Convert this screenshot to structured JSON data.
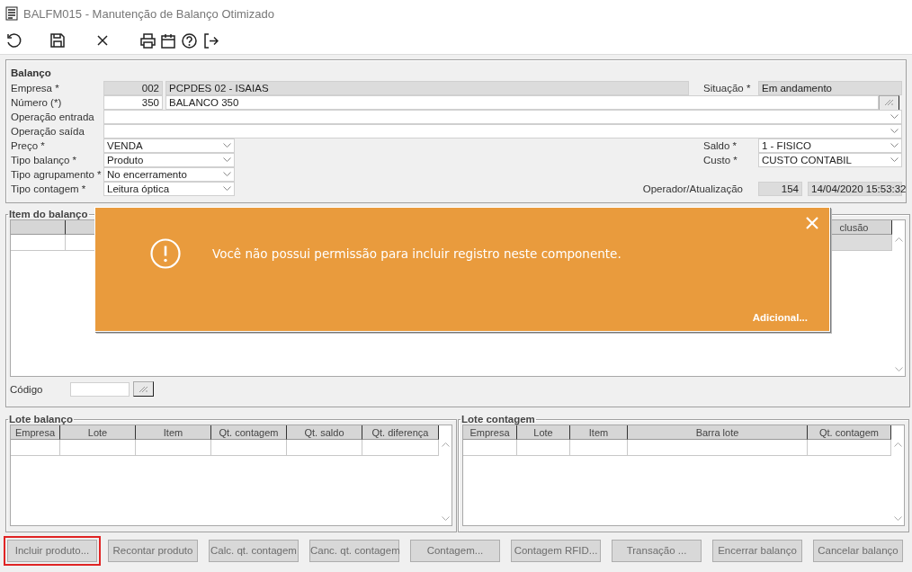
{
  "window": {
    "title": "BALFM015 - Manutenção de Balanço Otimizado"
  },
  "balanco": {
    "title": "Balanço",
    "empresa": {
      "label": "Empresa *",
      "code": "002",
      "name": "PCPDES 02 - ISAIAS",
      "readonly": true
    },
    "situacao": {
      "label": "Situação *",
      "value": "Em andamento",
      "readonly": true
    },
    "numero": {
      "label": "Número (*)",
      "code": "350",
      "name": "BALANCO 350",
      "readonly": false
    },
    "operacao_entrada": {
      "label": "Operação entrada"
    },
    "operacao_saida": {
      "label": "Operação saída"
    },
    "preco": {
      "label": "Preço *",
      "value": "VENDA"
    },
    "saldo": {
      "label": "Saldo *",
      "value": "1 - FISICO"
    },
    "tipo_balanco": {
      "label": "Tipo balanço *",
      "value": "Produto"
    },
    "custo": {
      "label": "Custo *",
      "value": "CUSTO CONTABIL"
    },
    "tipo_agrupamento": {
      "label": "Tipo agrupamento *",
      "value": "No encerramento"
    },
    "tipo_contagem": {
      "label": "Tipo contagem *",
      "value": "Leitura óptica"
    },
    "operador": {
      "label": "Operador/Atualização",
      "code": "154",
      "date": "14/04/2020 15:53:32"
    }
  },
  "item_balanco": {
    "title": "Item do balanço",
    "columns": [
      "clusão"
    ],
    "codigo": {
      "label": "Código"
    }
  },
  "toast": {
    "message": "Você não possui permissão para incluir registro neste componente.",
    "link": "Adicional..."
  },
  "lote_balanco": {
    "title": "Lote balanço",
    "columns": [
      "Empresa",
      "Lote",
      "Item",
      "Qt. contagem",
      "Qt. saldo",
      "Qt. diferença"
    ]
  },
  "lote_contagem": {
    "title": "Lote contagem",
    "columns": [
      "Empresa",
      "Lote",
      "Item",
      "Barra lote",
      "Qt. contagem"
    ]
  },
  "buttons": [
    {
      "label": "Incluir produto...",
      "disabled": true,
      "highlighted": true
    },
    {
      "label": "Recontar produto",
      "disabled": true,
      "highlighted": false
    },
    {
      "label": "Calc. qt. contagem",
      "disabled": true,
      "highlighted": false
    },
    {
      "label": "Canc. qt. contagem",
      "disabled": true,
      "highlighted": false
    },
    {
      "label": "Contagem...",
      "disabled": true,
      "highlighted": false
    },
    {
      "label": "Contagem RFID...",
      "disabled": true,
      "highlighted": false
    },
    {
      "label": "Transação ...",
      "disabled": true,
      "highlighted": false
    },
    {
      "label": "Encerrar balanço",
      "disabled": true,
      "highlighted": false
    },
    {
      "label": "Cancelar balanço",
      "disabled": true,
      "highlighted": false
    }
  ]
}
